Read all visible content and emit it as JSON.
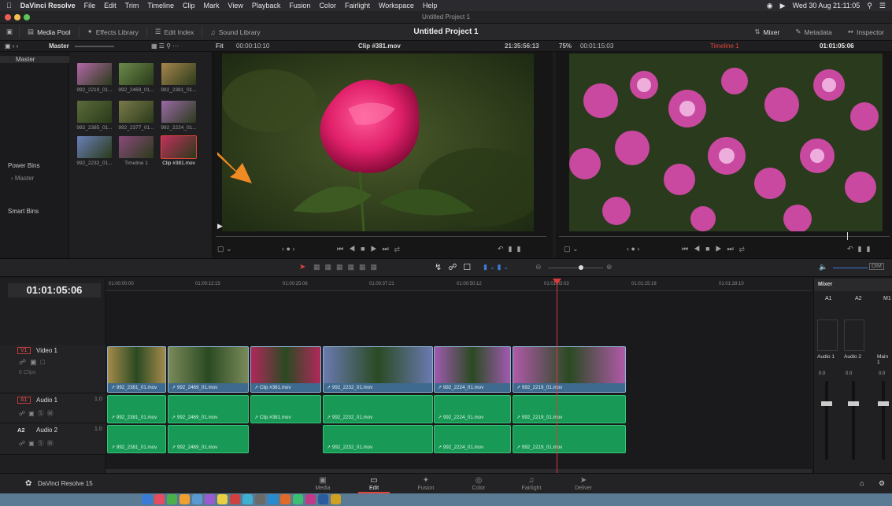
{
  "menubar": {
    "app": "DaVinci Resolve",
    "items": [
      "File",
      "Edit",
      "Trim",
      "Timeline",
      "Clip",
      "Mark",
      "View",
      "Playback",
      "Fusion",
      "Color",
      "Fairlight",
      "Workspace",
      "Help"
    ],
    "clock": "Wed 30 Aug  21:11:05"
  },
  "window_title": "Untitled Project 1",
  "toolbar": {
    "media_pool": "Media Pool",
    "effects_library": "Effects Library",
    "edit_index": "Edit Index",
    "sound_library": "Sound Library",
    "project_name": "Untitled Project 1",
    "mixer": "Mixer",
    "metadata": "Metadata",
    "inspector": "Inspector"
  },
  "viewer_header": {
    "bin": "Master",
    "fit": "Fit",
    "source_duration": "00:00:10:10",
    "clip_name": "Clip #381.mov",
    "source_tc": "21:35:56:13",
    "zoom": "75%",
    "timeline_duration": "00:01:15:03",
    "timeline_name": "Timeline 1",
    "timeline_tc": "01:01:05:06"
  },
  "bins": {
    "master": "Master",
    "power_bins": "Power Bins",
    "power_master": "Master",
    "smart_bins": "Smart Bins"
  },
  "pool_items": [
    {
      "label": "992_2219_01...",
      "color": "#b368a8"
    },
    {
      "label": "992_2469_01...",
      "color": "#6b8a4a"
    },
    {
      "label": "992_2381_01...",
      "color": "#a7864e"
    },
    {
      "label": "992_2385_01...",
      "color": "#5b6b3a"
    },
    {
      "label": "992_2377_01...",
      "color": "#7a7a4a"
    },
    {
      "label": "992_2224_01...",
      "color": "#9a6aa8"
    },
    {
      "label": "992_2232_01...",
      "color": "#6a7fb8"
    },
    {
      "label": "Timeline 1",
      "color": "#8a4a7a"
    },
    {
      "label": "Clip #381.mov",
      "color": "#c0305a"
    }
  ],
  "timecode": "01:01:05:06",
  "ruler": [
    "01:00:00:00",
    "01:00:12:15",
    "01:00:25:06",
    "01:00:37:21",
    "01:00:50:12",
    "01:01:03:03",
    "01:01:15:18",
    "01:01:28:10"
  ],
  "tracks": {
    "v1": {
      "tag": "V1",
      "name": "Video 1",
      "clips_count": "6 Clips"
    },
    "a1": {
      "tag": "A1",
      "name": "Audio 1",
      "level": "1.0"
    },
    "a2": {
      "tag": "A2",
      "name": "Audio 2",
      "level": "1.0"
    }
  },
  "video_clips": [
    {
      "name": "992_2381_01.mov",
      "color": "#a48a4a"
    },
    {
      "name": "992_2469_01.mov",
      "color": "#7a8a5a"
    },
    {
      "name": "Clip #381.mov",
      "color": "#b0285a"
    },
    {
      "name": "992_2232_01.mov",
      "color": "#6a7ab0"
    },
    {
      "name": "992_2224_01.mov",
      "color": "#a05ab0"
    },
    {
      "name": "992_2219_01.mov",
      "color": "#b05aa8"
    }
  ],
  "audio1_clips": [
    "992_2381_01.mov",
    "992_2469_01.mov",
    "Clip #381.mov",
    "992_2232_01.mov",
    "992_2224_01.mov",
    "992_2219_01.mov"
  ],
  "audio2_clips": [
    "992_2381_01.mov",
    "992_2469_01.mov",
    "992_2232_01.mov",
    "992_2224_01.mov",
    "992_2219_01.mov"
  ],
  "mixer": {
    "title": "Mixer",
    "ch1": "A1",
    "ch2": "A2",
    "ch3": "M1",
    "out1": "Audio 1",
    "out2": "Audio 2",
    "out3": "Main 1",
    "val": "0.0"
  },
  "pages": [
    "Media",
    "Edit",
    "Fusion",
    "Color",
    "Fairlight",
    "Deliver"
  ],
  "active_page": "Edit",
  "brand": "DaVinci Resolve 15",
  "dock_colors": [
    "#3a7bd5",
    "#e84a5f",
    "#4ab04a",
    "#f0a030",
    "#5a9ad0",
    "#9a5ad0",
    "#e8d040",
    "#d04040",
    "#40b0d0",
    "#6a6a6a",
    "#2a8ad0",
    "#e06a2a",
    "#3ac070",
    "#c03a8a",
    "#2a5aa0",
    "#d0a020"
  ]
}
